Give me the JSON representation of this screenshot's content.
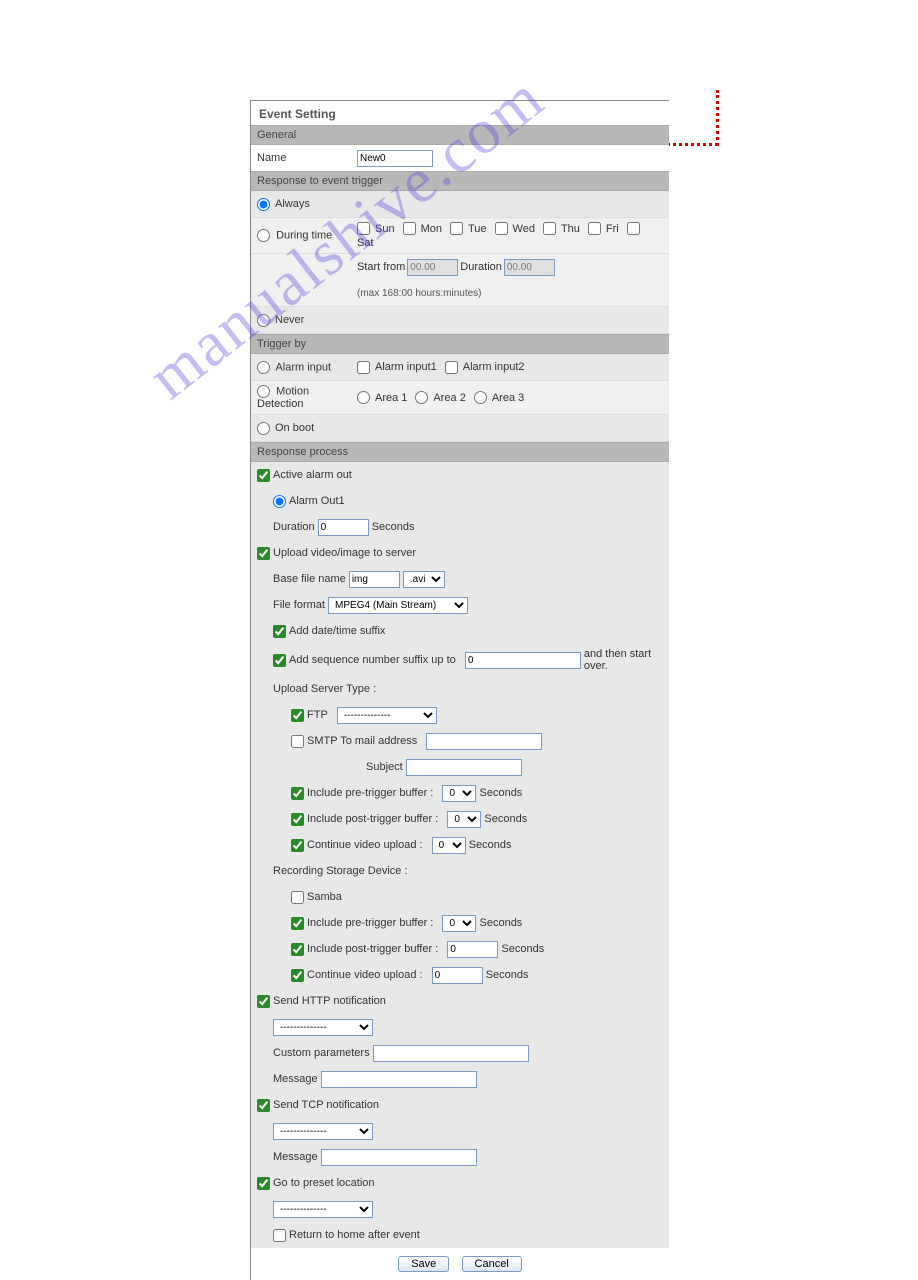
{
  "watermark": "manualshive.com",
  "title": "Event Setting",
  "sections": {
    "general": "General",
    "response_trigger": "Response to event trigger",
    "trigger_by": "Trigger by",
    "response_process": "Response process"
  },
  "general": {
    "name_label": "Name",
    "name_value": "New0"
  },
  "response": {
    "always": "Always",
    "during_time": "During time",
    "days": {
      "sun": "Sun",
      "mon": "Mon",
      "tue": "Tue",
      "wed": "Wed",
      "thu": "Thu",
      "fri": "Fri",
      "sat": "Sat"
    },
    "start_from": "Start from",
    "start_value": "00.00",
    "duration": "Duration",
    "duration_value": "00.00",
    "max_note": "(max 168:00 hours:minutes)",
    "never": "Never"
  },
  "trigger": {
    "alarm_input": "Alarm input",
    "alarm_input1": "Alarm input1",
    "alarm_input2": "Alarm input2",
    "motion_detection": "Motion Detection",
    "area1": "Area 1",
    "area2": "Area 2",
    "area3": "Area 3",
    "on_boot": "On boot"
  },
  "process": {
    "active_alarm_out": "Active alarm out",
    "alarm_out1": "Alarm Out1",
    "duration_label": "Duration",
    "duration_value": "0",
    "seconds": "Seconds",
    "upload_label": "Upload video/image to server",
    "base_file_name": "Base file name",
    "base_file_value": "img",
    "ext_value": ".avi",
    "file_format": "File format",
    "file_format_value": "MPEG4 (Main Stream)",
    "add_datetime": "Add date/time suffix",
    "add_seq": "Add sequence number suffix up to",
    "seq_value": "0",
    "seq_after": "and then start over.",
    "upload_server_type": "Upload Server Type :",
    "ftp": "FTP",
    "ftp_value": "--------------",
    "smtp": "SMTP To mail address",
    "subject": "Subject",
    "inc_pre": "Include pre-trigger buffer :",
    "pre_value": "0",
    "inc_post": "Include post-trigger buffer :",
    "post_value": "0",
    "cont_upload": "Continue video upload :",
    "cont_value": "0",
    "rec_storage": "Recording Storage Device :",
    "samba": "Samba",
    "post_value2": "0",
    "cont_value2": "0",
    "send_http": "Send HTTP notification",
    "http_value": "--------------",
    "custom_params": "Custom parameters",
    "message": "Message",
    "send_tcp": "Send TCP notification",
    "tcp_value": "--------------",
    "goto_preset": "Go to preset location",
    "preset_value": "--------------",
    "return_home": "Return to home after event"
  },
  "buttons": {
    "save": "Save",
    "cancel": "Cancel"
  }
}
